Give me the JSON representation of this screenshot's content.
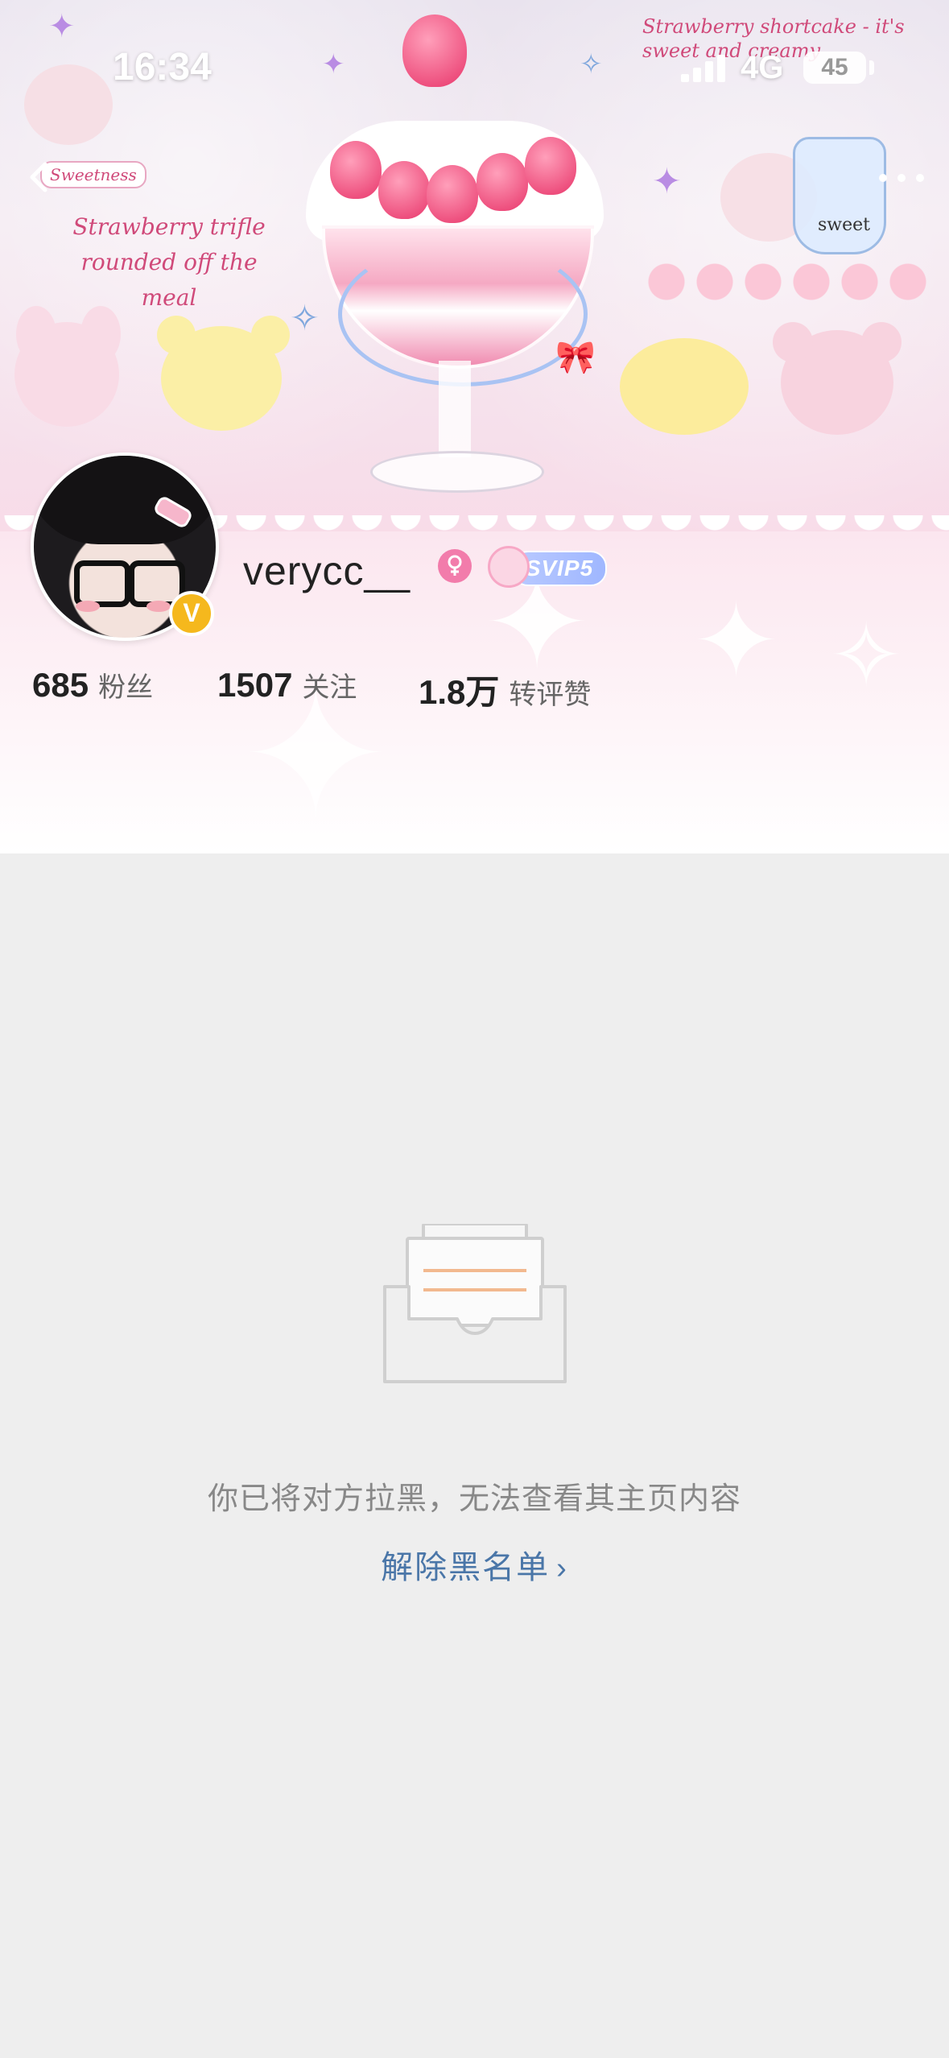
{
  "status_bar": {
    "time": "16:34",
    "network": "4G",
    "battery": "45"
  },
  "banner": {
    "sticker_top_right": "Strawberry shortcake - it's sweet and creamy",
    "sticker_left": "Strawberry trifle rounded off the meal",
    "sticker_badge": "Sweetness",
    "cup_label": "sweet"
  },
  "profile": {
    "username": "verycc__",
    "verified_mark": "V",
    "vip_label": "SVIP5",
    "stats": [
      {
        "value": "685",
        "label": "粉丝"
      },
      {
        "value": "1507",
        "label": "关注"
      },
      {
        "value": "1.8万",
        "label": "转评赞"
      }
    ]
  },
  "empty_state": {
    "message": "你已将对方拉黑，无法查看其主页内容",
    "action_label": "解除黑名单",
    "action_chevron": "›"
  },
  "colors": {
    "page_background": "#eeeeee",
    "link": "#4a76a8",
    "gender_badge": "#f27cab",
    "verified_badge": "#f5b81d"
  }
}
